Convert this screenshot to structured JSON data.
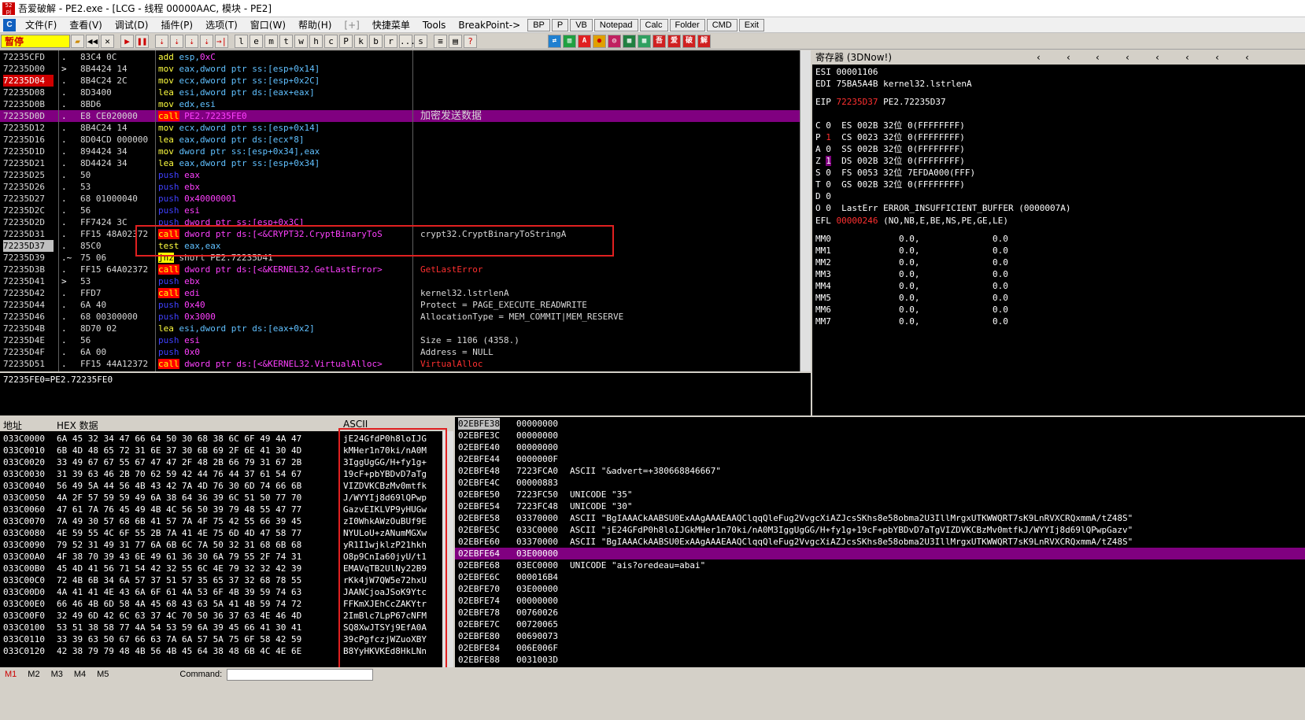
{
  "title": "吾爱破解 - PE2.exe - [LCG - 线程 00000AAC, 模块 - PE2]",
  "app_icon_text": "吾爱破解",
  "menu": [
    "文件(F)",
    "查看(V)",
    "调试(D)",
    "插件(P)",
    "选项(T)",
    "窗口(W)",
    "帮助(H)",
    "[+]",
    "快捷菜单",
    "Tools",
    "BreakPoint->"
  ],
  "menu_buttons": [
    "BP",
    "P",
    "VB",
    "Notepad",
    "Calc",
    "Folder",
    "CMD",
    "Exit"
  ],
  "status_paused": "暂停",
  "toolbar_letters": [
    "l",
    "e",
    "m",
    "t",
    "w",
    "h",
    "c",
    "P",
    "k",
    "b",
    "r",
    "...",
    "s"
  ],
  "toolbar_nav": [
    "◀◀",
    "✕",
    "▶",
    "❚❚",
    "⇣",
    "⇣",
    "⇣",
    "⇣",
    "→|"
  ],
  "toolbar_right": [
    "≡",
    "▤",
    "?"
  ],
  "toolbar_icons": [
    "⇄",
    "▥",
    "A",
    "●",
    "◎",
    "▦",
    "▦",
    "吾",
    "爱",
    "破",
    "解"
  ],
  "disasm": [
    {
      "addr": "72235CFD",
      "mark": ".",
      "hex": "83C4 0C",
      "op": "add",
      "args": "esp,",
      "imm": "0xC",
      "kind": "normal",
      "comment": ""
    },
    {
      "addr": "72235D00",
      "mark": ">",
      "hex": "8B4424 14",
      "op": "mov",
      "args": "eax,dword ptr ss:[esp+0x14]",
      "kind": "normal",
      "comment": ""
    },
    {
      "addr": "72235D04",
      "mark": ".",
      "hex": "8B4C24 2C",
      "op": "mov",
      "args": "ecx,dword ptr ss:[esp+0x2C]",
      "kind": "normal",
      "comment": "",
      "addrred": true
    },
    {
      "addr": "72235D08",
      "mark": ".",
      "hex": "8D3400",
      "op": "lea",
      "args": "esi,dword ptr ds:[eax+eax]",
      "kind": "normal",
      "comment": ""
    },
    {
      "addr": "72235D0B",
      "mark": ".",
      "hex": "8BD6",
      "op": "mov",
      "args": "edx,esi",
      "kind": "normal",
      "comment": ""
    },
    {
      "addr": "72235D0D",
      "mark": ".",
      "hex": "E8 CE020000",
      "op": "call",
      "args": "PE2.72235FE0",
      "kind": "call",
      "comment": "加密发送数据",
      "hl": true
    },
    {
      "addr": "72235D12",
      "mark": ".",
      "hex": "8B4C24 14",
      "op": "mov",
      "args": "ecx,dword ptr ss:[esp+0x14]",
      "kind": "normal",
      "comment": ""
    },
    {
      "addr": "72235D16",
      "mark": ".",
      "hex": "8D04CD 000000",
      "op": "lea",
      "args": "eax,dword ptr ds:[ecx*8]",
      "kind": "normal",
      "comment": ""
    },
    {
      "addr": "72235D1D",
      "mark": ".",
      "hex": "894424 34",
      "op": "mov",
      "args": "dword ptr ss:[esp+0x34],eax",
      "kind": "normal",
      "comment": ""
    },
    {
      "addr": "72235D21",
      "mark": ".",
      "hex": "8D4424 34",
      "op": "lea",
      "args": "eax,dword ptr ss:[esp+0x34]",
      "kind": "normal",
      "comment": ""
    },
    {
      "addr": "72235D25",
      "mark": ".",
      "hex": "50",
      "op": "push",
      "args": "eax",
      "kind": "push",
      "comment": ""
    },
    {
      "addr": "72235D26",
      "mark": ".",
      "hex": "53",
      "op": "push",
      "args": "ebx",
      "kind": "push",
      "comment": ""
    },
    {
      "addr": "72235D27",
      "mark": ".",
      "hex": "68 01000040",
      "op": "push",
      "args": "0x40000001",
      "kind": "push",
      "comment": ""
    },
    {
      "addr": "72235D2C",
      "mark": ".",
      "hex": "56",
      "op": "push",
      "args": "esi",
      "kind": "push",
      "comment": ""
    },
    {
      "addr": "72235D2D",
      "mark": ".",
      "hex": "FF7424 3C",
      "op": "push",
      "args": "dword ptr ss:[esp+0x3C]",
      "kind": "push",
      "comment": ""
    },
    {
      "addr": "72235D31",
      "mark": ".",
      "hex": "FF15 48A02372",
      "op": "call",
      "args": "dword ptr ds:[<&CRYPT32.CryptBinaryToS",
      "kind": "call",
      "comment": "crypt32.CryptBinaryToStringA"
    },
    {
      "addr": "72235D37",
      "mark": ".",
      "hex": "85C0",
      "op": "test",
      "args": "eax,eax",
      "kind": "test",
      "comment": "",
      "addrsel": true
    },
    {
      "addr": "72235D39",
      "mark": ".~",
      "hex": "75 06",
      "op": "jnz",
      "args": "short PE2.72235D41",
      "kind": "jnz",
      "comment": ""
    },
    {
      "addr": "72235D3B",
      "mark": ".",
      "hex": "FF15 64A02372",
      "op": "call",
      "args": "dword ptr ds:[<&KERNEL32.GetLastError>",
      "kind": "call",
      "comment": "GetLastError",
      "comred": true
    },
    {
      "addr": "72235D41",
      "mark": ">",
      "hex": "53",
      "op": "push",
      "args": "ebx",
      "kind": "push",
      "comment": ""
    },
    {
      "addr": "72235D42",
      "mark": ".",
      "hex": "FFD7",
      "op": "call",
      "args": "edi",
      "kind": "call",
      "comment": "kernel32.lstrlenA"
    },
    {
      "addr": "72235D44",
      "mark": ".",
      "hex": "6A 40",
      "op": "push",
      "args": "0x40",
      "kind": "push",
      "comment": "Protect = PAGE_EXECUTE_READWRITE"
    },
    {
      "addr": "72235D46",
      "mark": ".",
      "hex": "68 00300000",
      "op": "push",
      "args": "0x3000",
      "kind": "push",
      "comment": "AllocationType = MEM_COMMIT|MEM_RESERVE"
    },
    {
      "addr": "72235D4B",
      "mark": ".",
      "hex": "8D70 02",
      "op": "lea",
      "args": "esi,dword ptr ds:[eax+0x2]",
      "kind": "normal",
      "comment": ""
    },
    {
      "addr": "72235D4E",
      "mark": ".",
      "hex": "56",
      "op": "push",
      "args": "esi",
      "kind": "push",
      "comment": "Size = 1106 (4358.)"
    },
    {
      "addr": "72235D4F",
      "mark": ".",
      "hex": "6A 00",
      "op": "push",
      "args": "0x0",
      "kind": "push",
      "comment": "Address = NULL"
    },
    {
      "addr": "72235D51",
      "mark": ".",
      "hex": "FF15 44A12372",
      "op": "call",
      "args": "dword ptr ds:[<&KERNEL32.VirtualAlloc>",
      "kind": "call",
      "comment": "VirtualAlloc",
      "comred": true
    }
  ],
  "info_line": "72235FE0=PE2.72235FE0",
  "registers": {
    "title": "寄存器 (3DNow!)",
    "esi": "ESI 00001106",
    "edi": "EDI 75BA5A4B kernel32.lstrlenA",
    "eip_label": "EIP",
    "eip_value": "72235D37",
    "eip_sym": "PE2.72235D37",
    "flags": [
      {
        "f": "C",
        "v": "0",
        "seg": "ES 002B 32位 0(FFFFFFFF)"
      },
      {
        "f": "P",
        "v": "1",
        "seg": "CS 0023 32位 0(FFFFFFFF)",
        "red": true
      },
      {
        "f": "A",
        "v": "0",
        "seg": "SS 002B 32位 0(FFFFFFFF)"
      },
      {
        "f": "Z",
        "v": "1",
        "seg": "DS 002B 32位 0(FFFFFFFF)",
        "sel": true
      },
      {
        "f": "S",
        "v": "0",
        "seg": "FS 0053 32位 7EFDA000(FFF)"
      },
      {
        "f": "T",
        "v": "0",
        "seg": "GS 002B 32位 0(FFFFFFFF)"
      },
      {
        "f": "D",
        "v": "0",
        "seg": ""
      },
      {
        "f": "O",
        "v": "0",
        "seg": "LastErr ERROR_INSUFFICIENT_BUFFER (0000007A)"
      }
    ],
    "efl_label": "EFL",
    "efl_value": "00000246",
    "efl_desc": "(NO,NB,E,BE,NS,PE,GE,LE)",
    "mm": [
      "MM0",
      "MM1",
      "MM2",
      "MM3",
      "MM4",
      "MM5",
      "MM6",
      "MM7"
    ],
    "mm_val1": "0.0,",
    "mm_val2": "0.0"
  },
  "dump": {
    "col_addr": "地址",
    "col_hex": "HEX 数据",
    "col_ascii": "ASCII",
    "rows": [
      [
        "033C0000",
        "6A 45 32 34 47 66 64 50 30 68 38 6C 6F 49 4A 47",
        "jE24GfdP0h8loIJG"
      ],
      [
        "033C0010",
        "6B 4D 48 65 72 31 6E 37 30 6B 69 2F 6E 41 30 4D",
        "kMHer1n70ki/nA0M"
      ],
      [
        "033C0020",
        "33 49 67 67 55 67 47 47 2F 48 2B 66 79 31 67 2B",
        "3IggUgGG/H+fy1g+"
      ],
      [
        "033C0030",
        "31 39 63 46 2B 70 62 59 42 44 76 44 37 61 54 67",
        "19cF+pbYBDvD7aTg"
      ],
      [
        "033C0040",
        "56 49 5A 44 56 4B 43 42 7A 4D 76 30 6D 74 66 6B",
        "VIZDVKCBzMv0mtfk"
      ],
      [
        "033C0050",
        "4A 2F 57 59 59 49 6A 38 64 36 39 6C 51 50 77 70",
        "J/WYYIj8d69lQPwp"
      ],
      [
        "033C0060",
        "47 61 7A 76 45 49 4B 4C 56 50 39 79 48 55 47 77",
        "GazvEIKLVP9yHUGw"
      ],
      [
        "033C0070",
        "7A 49 30 57 68 6B 41 57 7A 4F 75 42 55 66 39 45",
        "zI0WhkAWzOuBUf9E"
      ],
      [
        "033C0080",
        "4E 59 55 4C 6F 55 2B 7A 41 4E 75 6D 4D 47 58 77",
        "NYULoU+zANumMGXw"
      ],
      [
        "033C0090",
        "79 52 31 49 31 77 6A 6B 6C 7A 50 32 31 68 6B 68",
        "yR1I1wjklzP21hkh"
      ],
      [
        "033C00A0",
        "4F 38 70 39 43 6E 49 61 36 30 6A 79 55 2F 74 31",
        "O8p9CnIa60jyU/t1"
      ],
      [
        "033C00B0",
        "45 4D 41 56 71 54 42 32 55 6C 4E 79 32 32 42 39",
        "EMAVqTB2UlNy22B9"
      ],
      [
        "033C00C0",
        "72 4B 6B 34 6A 57 37 51 57 35 65 37 32 68 78 55",
        "rKk4jW7QW5e72hxU"
      ],
      [
        "033C00D0",
        "4A 41 41 4E 43 6A 6F 61 4A 53 6F 4B 39 59 74 63",
        "JAANCjoaJSoK9Ytc"
      ],
      [
        "033C00E0",
        "66 46 4B 6D 58 4A 45 68 43 63 5A 41 4B 59 74 72",
        "FFKmXJEhCcZAKYtr"
      ],
      [
        "033C00F0",
        "32 49 6D 42 6C 63 37 4C 70 50 36 37 63 4E 46 4D",
        "2ImBlc7LpP67cNFM"
      ],
      [
        "033C0100",
        "53 51 38 58 77 4A 54 53 59 6A 39 45 66 41 30 41",
        "SQ8XwJTSYj9EfA0A"
      ],
      [
        "033C0110",
        "33 39 63 50 67 66 63 7A 6A 57 5A 75 6F 58 42 59",
        "39cPgfczjWZuoXBY"
      ],
      [
        "033C0120",
        "42 38 79 79 48 4B 56 4B 45 64 38 48 6B 4C 4E 6E",
        "B8YyHKVKEd8HkLNn"
      ]
    ]
  },
  "stack": [
    {
      "addr": "02EBFE38",
      "val": "00000000",
      "com": "",
      "sel": true
    },
    {
      "addr": "02EBFE3C",
      "val": "00000000",
      "com": ""
    },
    {
      "addr": "02EBFE40",
      "val": "00000000",
      "com": ""
    },
    {
      "addr": "02EBFE44",
      "val": "0000000F",
      "com": ""
    },
    {
      "addr": "02EBFE48",
      "val": "7223FCA0",
      "com": "ASCII \"&advert=+380668846667\""
    },
    {
      "addr": "02EBFE4C",
      "val": "00000883",
      "com": ""
    },
    {
      "addr": "02EBFE50",
      "val": "7223FC50",
      "com": "UNICODE \"35\""
    },
    {
      "addr": "02EBFE54",
      "val": "7223FC48",
      "com": "UNICODE \"30\""
    },
    {
      "addr": "02EBFE58",
      "val": "03370000",
      "com": "ASCII \"BgIAAACkAABSU0ExAAgAAAEAAQClqqQleFug2VvgcXiAZJcsSKhs8e58obma2U3IllMrgxUTKWWQRT7sK9LnRVXCRQxmmA/tZ48S\""
    },
    {
      "addr": "02EBFE5C",
      "val": "033C0000",
      "com": "ASCII \"jE24GFdP0h8loIJGkMHer1n70ki/nA0M3IggUgGG/H+fy1g+19cF+pbYBDvD7aTgVIZDVKCBzMv0mtfkJ/WYYIj8d69lQPwpGazv\""
    },
    {
      "addr": "02EBFE60",
      "val": "03370000",
      "com": "ASCII \"BgIAAACkAABSU0ExAAgAAAEAAQClqqQleFug2VvgcXiAZJcsSKhs8e58obma2U3IllMrgxUTKWWQRT7sK9LnRVXCRQxmmA/tZ48S\""
    },
    {
      "addr": "02EBFE64",
      "val": "03E00000",
      "com": "",
      "hl": true
    },
    {
      "addr": "02EBFE68",
      "val": "03EC0000",
      "com": "UNICODE \"ais?oredeau=abai\""
    },
    {
      "addr": "02EBFE6C",
      "val": "000016B4",
      "com": ""
    },
    {
      "addr": "02EBFE70",
      "val": "03E00000",
      "com": ""
    },
    {
      "addr": "02EBFE74",
      "val": "00000000",
      "com": ""
    },
    {
      "addr": "02EBFE78",
      "val": "00760026",
      "com": ""
    },
    {
      "addr": "02EBFE7C",
      "val": "00720065",
      "com": ""
    },
    {
      "addr": "02EBFE80",
      "val": "00690073",
      "com": ""
    },
    {
      "addr": "02EBFE84",
      "val": "006E006F",
      "com": ""
    },
    {
      "addr": "02EBFE88",
      "val": "0031003D",
      "com": ""
    }
  ],
  "status": {
    "m_tabs": [
      "M1",
      "M2",
      "M3",
      "M4",
      "M5"
    ],
    "command_label": "Command:"
  }
}
